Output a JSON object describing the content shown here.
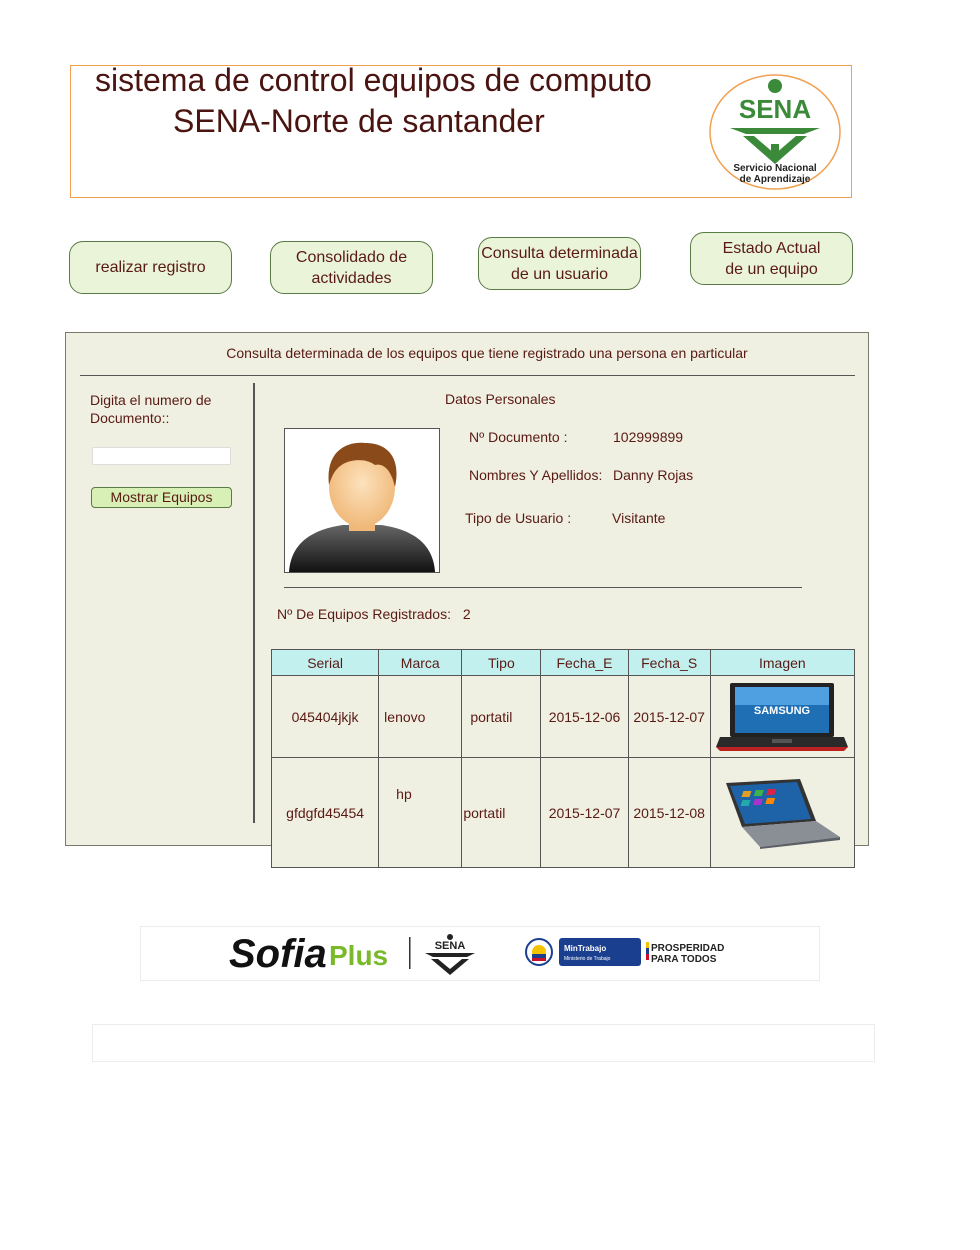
{
  "header": {
    "title_line1": "sistema de control equipos de computo",
    "title_line2": "SENA-Norte de santander",
    "logo_text": "SENA",
    "logo_caption1": "Servicio Nacional",
    "logo_caption2": "de Aprendizaje"
  },
  "nav": {
    "btn1": "realizar registro",
    "btn2_line1": "Consolidado de",
    "btn2_line2": "actividades",
    "btn3_line1": "Consulta determinada",
    "btn3_line2": "de un usuario",
    "btn4_line1": "Estado Actual",
    "btn4_line2": "de un equipo"
  },
  "panel": {
    "title": "Consulta determinada de los equipos que tiene registrado una persona en particular",
    "doc_label_line1": "Digita el numero de",
    "doc_label_line2": "Documento::",
    "doc_input_value": "",
    "show_button": "Mostrar Equipos",
    "personal_label": "Datos Personales",
    "doc_field_label": "Nº Documento    :",
    "doc_field_value": "102999899",
    "name_field_label": "Nombres Y Apellidos:",
    "name_field_value": "Danny Rojas",
    "type_field_label": "Tipo de Usuario    :",
    "type_field_value": "Visitante",
    "count_label": "Nº De Equipos Registrados:",
    "count_value": "2"
  },
  "table": {
    "headers": [
      "Serial",
      "Marca",
      "Tipo",
      "Fecha_E",
      "Fecha_S",
      "Imagen"
    ],
    "rows": [
      {
        "serial": "045404jkjk",
        "marca": "lenovo",
        "tipo": "portatil",
        "fecha_e": "2015-12-06",
        "fecha_s": "2015-12-07",
        "brand_on_screen": "SAMSUNG"
      },
      {
        "serial": "gfdgfd45454",
        "marca": "hp",
        "tipo": "portatil",
        "fecha_e": "2015-12-07",
        "fecha_s": "2015-12-08",
        "brand_on_screen": ""
      }
    ]
  },
  "footer": {
    "sofia": "Sofia",
    "plus": "Plus",
    "sena": "SENA",
    "mintrabajo": "MinTrabajo",
    "mintrabajo_sub": "Ministerio de Trabajo",
    "prosperidad1": "PROSPERIDAD",
    "prosperidad2": "PARA TODOS"
  },
  "colors": {
    "header_border": "#f0a050",
    "nav_bg": "#eaf4d8",
    "panel_bg": "#efefe2",
    "table_header_bg": "#c2f0ef",
    "sena_green": "#3a8a3a",
    "text": "#5a1a14"
  }
}
